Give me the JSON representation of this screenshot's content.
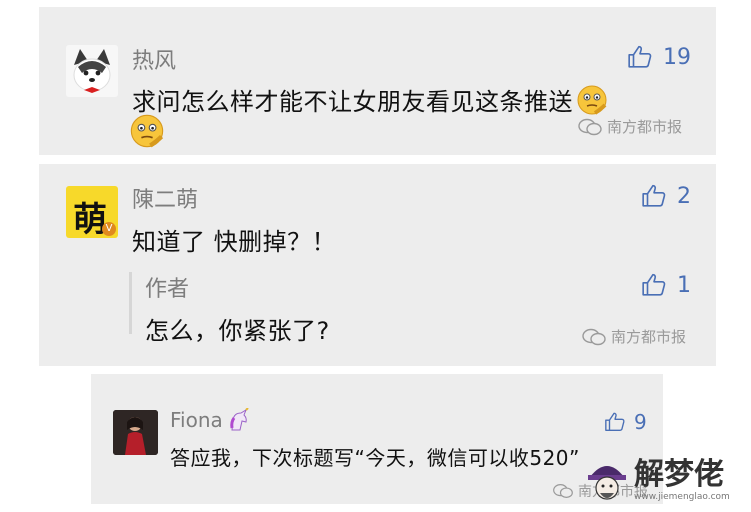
{
  "comments": [
    {
      "author": "热风",
      "text_line1": "求问怎么样才能不让女朋友看见这条推送",
      "likes": "19",
      "watermark": "南方都市报"
    },
    {
      "author": "陳二萌",
      "avatar_char": "萌",
      "avatar_badge": "V",
      "text": "知道了 快删掉？！",
      "likes": "2",
      "reply": {
        "author": "作者",
        "text": "怎么，你紧张了?",
        "likes": "1"
      },
      "watermark": "南方都市报"
    },
    {
      "author": "Fiona",
      "text": "答应我，下次标题写“今天，微信可以收520”",
      "likes": "9",
      "watermark": "南方都市报"
    }
  ],
  "site_logo": {
    "name": "解梦佬",
    "url": "www.jiemenglao.com"
  },
  "colors": {
    "card_bg": "#ededed",
    "like_blue": "#4a6fb5",
    "name_gray": "#7d7d7d"
  }
}
